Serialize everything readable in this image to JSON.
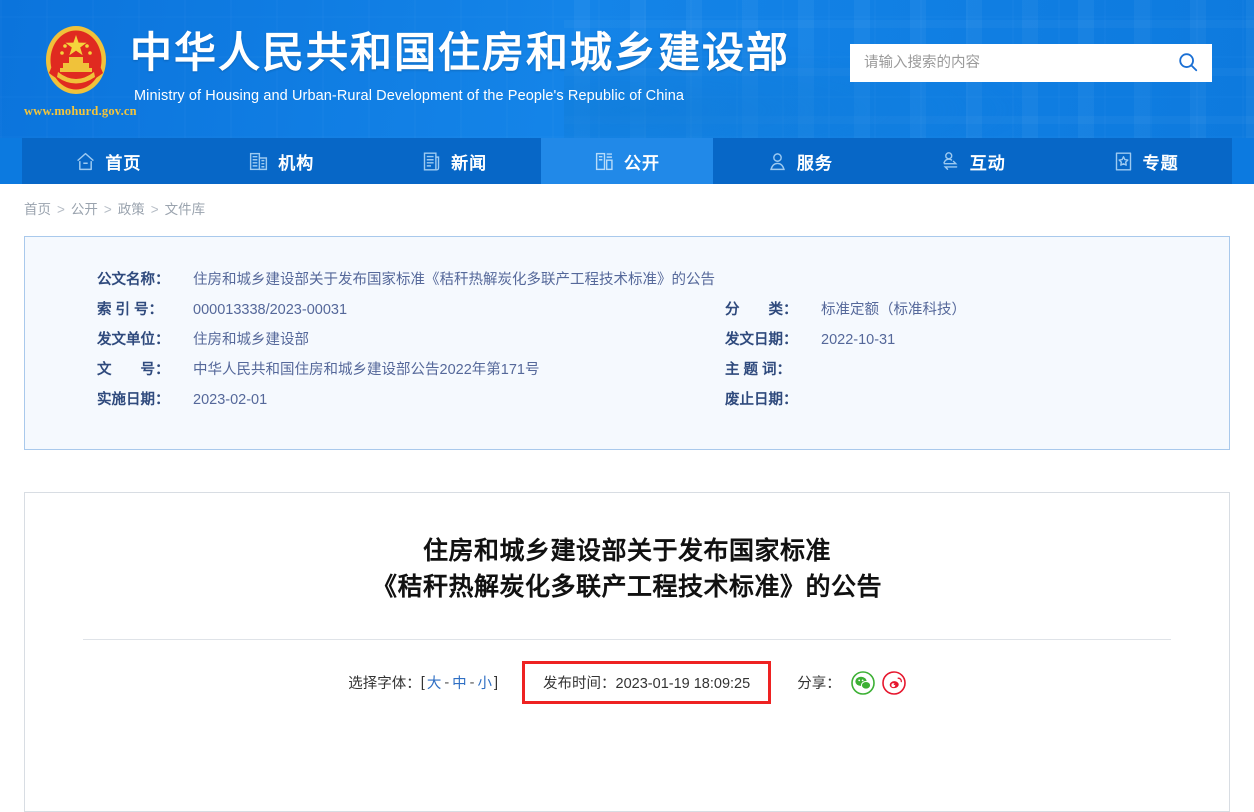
{
  "header": {
    "emblem_icon": "china-national-emblem",
    "site_url": "www.mohurd.gov.cn",
    "brand_cn": "中华人民共和国住房和城乡建设部",
    "brand_en": "Ministry of Housing and Urban-Rural Development of the People's Republic of China",
    "search": {
      "placeholder": "请输入搜索的内容",
      "value": "",
      "icon": "search-icon"
    },
    "colors": {
      "header_blue": "#0c7ae0",
      "nav_blue": "#0767c7",
      "nav_active_blue": "#2189e8",
      "url_yellow": "#f3c53c"
    }
  },
  "nav": {
    "items": [
      {
        "label": "首页",
        "icon": "home-icon",
        "active": false
      },
      {
        "label": "机构",
        "icon": "building-icon",
        "active": false
      },
      {
        "label": "新闻",
        "icon": "news-icon",
        "active": false
      },
      {
        "label": "公开",
        "icon": "open-info-icon",
        "active": true
      },
      {
        "label": "服务",
        "icon": "person-service-icon",
        "active": false
      },
      {
        "label": "互动",
        "icon": "interaction-icon",
        "active": false
      },
      {
        "label": "专题",
        "icon": "star-topic-icon",
        "active": false
      }
    ]
  },
  "breadcrumb": {
    "items": [
      "首页",
      "公开",
      "政策",
      "文件库"
    ],
    "separator": ">"
  },
  "info_card": {
    "rows": [
      {
        "left_label": "公文名称：",
        "left_value": "住房和城乡建设部关于发布国家标准《秸秆热解炭化多联产工程技术标准》的公告",
        "right_label": "",
        "right_value": ""
      },
      {
        "left_label": "索 引 号：",
        "left_value": "000013338/2023-00031",
        "right_label": "分　　类：",
        "right_value": "标准定额（标准科技）"
      },
      {
        "left_label": "发文单位：",
        "left_value": "住房和城乡建设部",
        "right_label": "发文日期：",
        "right_value": "2022-10-31"
      },
      {
        "left_label": "文　　号：",
        "left_value": "中华人民共和国住房和城乡建设部公告2022年第171号",
        "right_label": "主 题 词：",
        "right_value": ""
      },
      {
        "left_label": "实施日期：",
        "left_value": "2023-02-01",
        "right_label": "废止日期：",
        "right_value": ""
      }
    ]
  },
  "document": {
    "title_line1": "住房和城乡建设部关于发布国家标准",
    "title_line2": "《秸秆热解炭化多联产工程技术标准》的公告",
    "font_picker": {
      "label": "选择字体：",
      "open_bracket": "[",
      "close_bracket": "]",
      "options": [
        "大",
        "中",
        "小"
      ],
      "dash": "-"
    },
    "publish_time": {
      "label": "发布时间：",
      "value": "2023-01-19 18:09:25",
      "highlight_color": "#ee2222"
    },
    "share": {
      "label": "分享：",
      "items": [
        {
          "name": "wechat-share-icon",
          "color": "#3cb034"
        },
        {
          "name": "weibo-share-icon",
          "color": "#e6162d"
        }
      ]
    }
  }
}
